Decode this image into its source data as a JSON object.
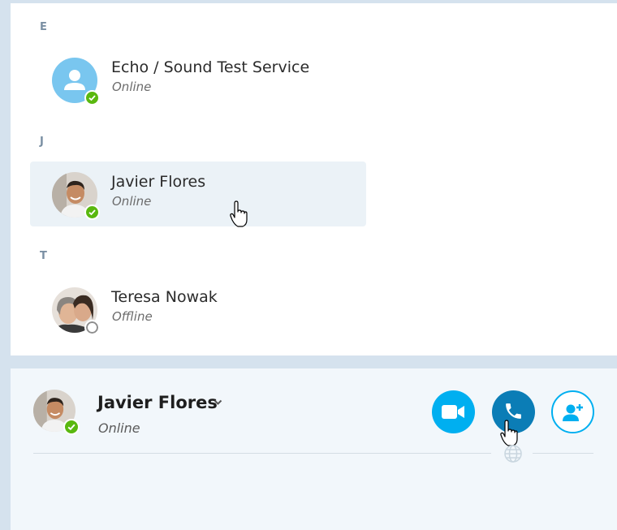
{
  "contacts": {
    "groups": [
      {
        "letter": "E",
        "items": [
          {
            "name": "Echo / Sound Test Service",
            "status": "Online",
            "state": "online",
            "avatar": "default-person-icon"
          }
        ]
      },
      {
        "letter": "J",
        "items": [
          {
            "name": "Javier Flores",
            "status": "Online",
            "state": "online",
            "avatar": "photo",
            "selected": true
          }
        ]
      },
      {
        "letter": "T",
        "items": [
          {
            "name": "Teresa Nowak",
            "status": "Offline",
            "state": "offline",
            "avatar": "photo"
          }
        ]
      }
    ]
  },
  "conversation": {
    "name": "Javier Flores",
    "status": "Online",
    "actions": {
      "video": "video-call-icon",
      "call": "phone-call-icon",
      "add_people": "add-person-icon"
    }
  },
  "colors": {
    "accent": "#00aff0",
    "call": "#0b7db6",
    "online": "#5ab80f",
    "selected_row": "#ebf2f7",
    "panel_bg": "#f2f7fb"
  }
}
